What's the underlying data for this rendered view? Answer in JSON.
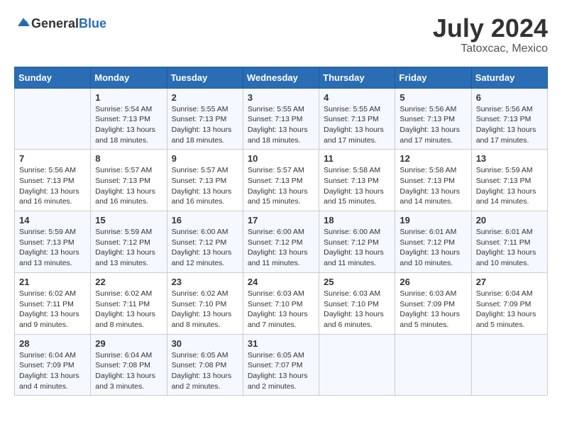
{
  "header": {
    "logo_general": "General",
    "logo_blue": "Blue",
    "title": "July 2024",
    "subtitle": "Tatoxcac, Mexico"
  },
  "days_of_week": [
    "Sunday",
    "Monday",
    "Tuesday",
    "Wednesday",
    "Thursday",
    "Friday",
    "Saturday"
  ],
  "weeks": [
    [
      {
        "day": "",
        "sunrise": "",
        "sunset": "",
        "daylight": ""
      },
      {
        "day": "1",
        "sunrise": "Sunrise: 5:54 AM",
        "sunset": "Sunset: 7:13 PM",
        "daylight": "Daylight: 13 hours and 18 minutes."
      },
      {
        "day": "2",
        "sunrise": "Sunrise: 5:55 AM",
        "sunset": "Sunset: 7:13 PM",
        "daylight": "Daylight: 13 hours and 18 minutes."
      },
      {
        "day": "3",
        "sunrise": "Sunrise: 5:55 AM",
        "sunset": "Sunset: 7:13 PM",
        "daylight": "Daylight: 13 hours and 18 minutes."
      },
      {
        "day": "4",
        "sunrise": "Sunrise: 5:55 AM",
        "sunset": "Sunset: 7:13 PM",
        "daylight": "Daylight: 13 hours and 17 minutes."
      },
      {
        "day": "5",
        "sunrise": "Sunrise: 5:56 AM",
        "sunset": "Sunset: 7:13 PM",
        "daylight": "Daylight: 13 hours and 17 minutes."
      },
      {
        "day": "6",
        "sunrise": "Sunrise: 5:56 AM",
        "sunset": "Sunset: 7:13 PM",
        "daylight": "Daylight: 13 hours and 17 minutes."
      }
    ],
    [
      {
        "day": "7",
        "sunrise": "Sunrise: 5:56 AM",
        "sunset": "Sunset: 7:13 PM",
        "daylight": "Daylight: 13 hours and 16 minutes."
      },
      {
        "day": "8",
        "sunrise": "Sunrise: 5:57 AM",
        "sunset": "Sunset: 7:13 PM",
        "daylight": "Daylight: 13 hours and 16 minutes."
      },
      {
        "day": "9",
        "sunrise": "Sunrise: 5:57 AM",
        "sunset": "Sunset: 7:13 PM",
        "daylight": "Daylight: 13 hours and 16 minutes."
      },
      {
        "day": "10",
        "sunrise": "Sunrise: 5:57 AM",
        "sunset": "Sunset: 7:13 PM",
        "daylight": "Daylight: 13 hours and 15 minutes."
      },
      {
        "day": "11",
        "sunrise": "Sunrise: 5:58 AM",
        "sunset": "Sunset: 7:13 PM",
        "daylight": "Daylight: 13 hours and 15 minutes."
      },
      {
        "day": "12",
        "sunrise": "Sunrise: 5:58 AM",
        "sunset": "Sunset: 7:13 PM",
        "daylight": "Daylight: 13 hours and 14 minutes."
      },
      {
        "day": "13",
        "sunrise": "Sunrise: 5:59 AM",
        "sunset": "Sunset: 7:13 PM",
        "daylight": "Daylight: 13 hours and 14 minutes."
      }
    ],
    [
      {
        "day": "14",
        "sunrise": "Sunrise: 5:59 AM",
        "sunset": "Sunset: 7:13 PM",
        "daylight": "Daylight: 13 hours and 13 minutes."
      },
      {
        "day": "15",
        "sunrise": "Sunrise: 5:59 AM",
        "sunset": "Sunset: 7:12 PM",
        "daylight": "Daylight: 13 hours and 13 minutes."
      },
      {
        "day": "16",
        "sunrise": "Sunrise: 6:00 AM",
        "sunset": "Sunset: 7:12 PM",
        "daylight": "Daylight: 13 hours and 12 minutes."
      },
      {
        "day": "17",
        "sunrise": "Sunrise: 6:00 AM",
        "sunset": "Sunset: 7:12 PM",
        "daylight": "Daylight: 13 hours and 11 minutes."
      },
      {
        "day": "18",
        "sunrise": "Sunrise: 6:00 AM",
        "sunset": "Sunset: 7:12 PM",
        "daylight": "Daylight: 13 hours and 11 minutes."
      },
      {
        "day": "19",
        "sunrise": "Sunrise: 6:01 AM",
        "sunset": "Sunset: 7:12 PM",
        "daylight": "Daylight: 13 hours and 10 minutes."
      },
      {
        "day": "20",
        "sunrise": "Sunrise: 6:01 AM",
        "sunset": "Sunset: 7:11 PM",
        "daylight": "Daylight: 13 hours and 10 minutes."
      }
    ],
    [
      {
        "day": "21",
        "sunrise": "Sunrise: 6:02 AM",
        "sunset": "Sunset: 7:11 PM",
        "daylight": "Daylight: 13 hours and 9 minutes."
      },
      {
        "day": "22",
        "sunrise": "Sunrise: 6:02 AM",
        "sunset": "Sunset: 7:11 PM",
        "daylight": "Daylight: 13 hours and 8 minutes."
      },
      {
        "day": "23",
        "sunrise": "Sunrise: 6:02 AM",
        "sunset": "Sunset: 7:10 PM",
        "daylight": "Daylight: 13 hours and 8 minutes."
      },
      {
        "day": "24",
        "sunrise": "Sunrise: 6:03 AM",
        "sunset": "Sunset: 7:10 PM",
        "daylight": "Daylight: 13 hours and 7 minutes."
      },
      {
        "day": "25",
        "sunrise": "Sunrise: 6:03 AM",
        "sunset": "Sunset: 7:10 PM",
        "daylight": "Daylight: 13 hours and 6 minutes."
      },
      {
        "day": "26",
        "sunrise": "Sunrise: 6:03 AM",
        "sunset": "Sunset: 7:09 PM",
        "daylight": "Daylight: 13 hours and 5 minutes."
      },
      {
        "day": "27",
        "sunrise": "Sunrise: 6:04 AM",
        "sunset": "Sunset: 7:09 PM",
        "daylight": "Daylight: 13 hours and 5 minutes."
      }
    ],
    [
      {
        "day": "28",
        "sunrise": "Sunrise: 6:04 AM",
        "sunset": "Sunset: 7:09 PM",
        "daylight": "Daylight: 13 hours and 4 minutes."
      },
      {
        "day": "29",
        "sunrise": "Sunrise: 6:04 AM",
        "sunset": "Sunset: 7:08 PM",
        "daylight": "Daylight: 13 hours and 3 minutes."
      },
      {
        "day": "30",
        "sunrise": "Sunrise: 6:05 AM",
        "sunset": "Sunset: 7:08 PM",
        "daylight": "Daylight: 13 hours and 2 minutes."
      },
      {
        "day": "31",
        "sunrise": "Sunrise: 6:05 AM",
        "sunset": "Sunset: 7:07 PM",
        "daylight": "Daylight: 13 hours and 2 minutes."
      },
      {
        "day": "",
        "sunrise": "",
        "sunset": "",
        "daylight": ""
      },
      {
        "day": "",
        "sunrise": "",
        "sunset": "",
        "daylight": ""
      },
      {
        "day": "",
        "sunrise": "",
        "sunset": "",
        "daylight": ""
      }
    ]
  ]
}
